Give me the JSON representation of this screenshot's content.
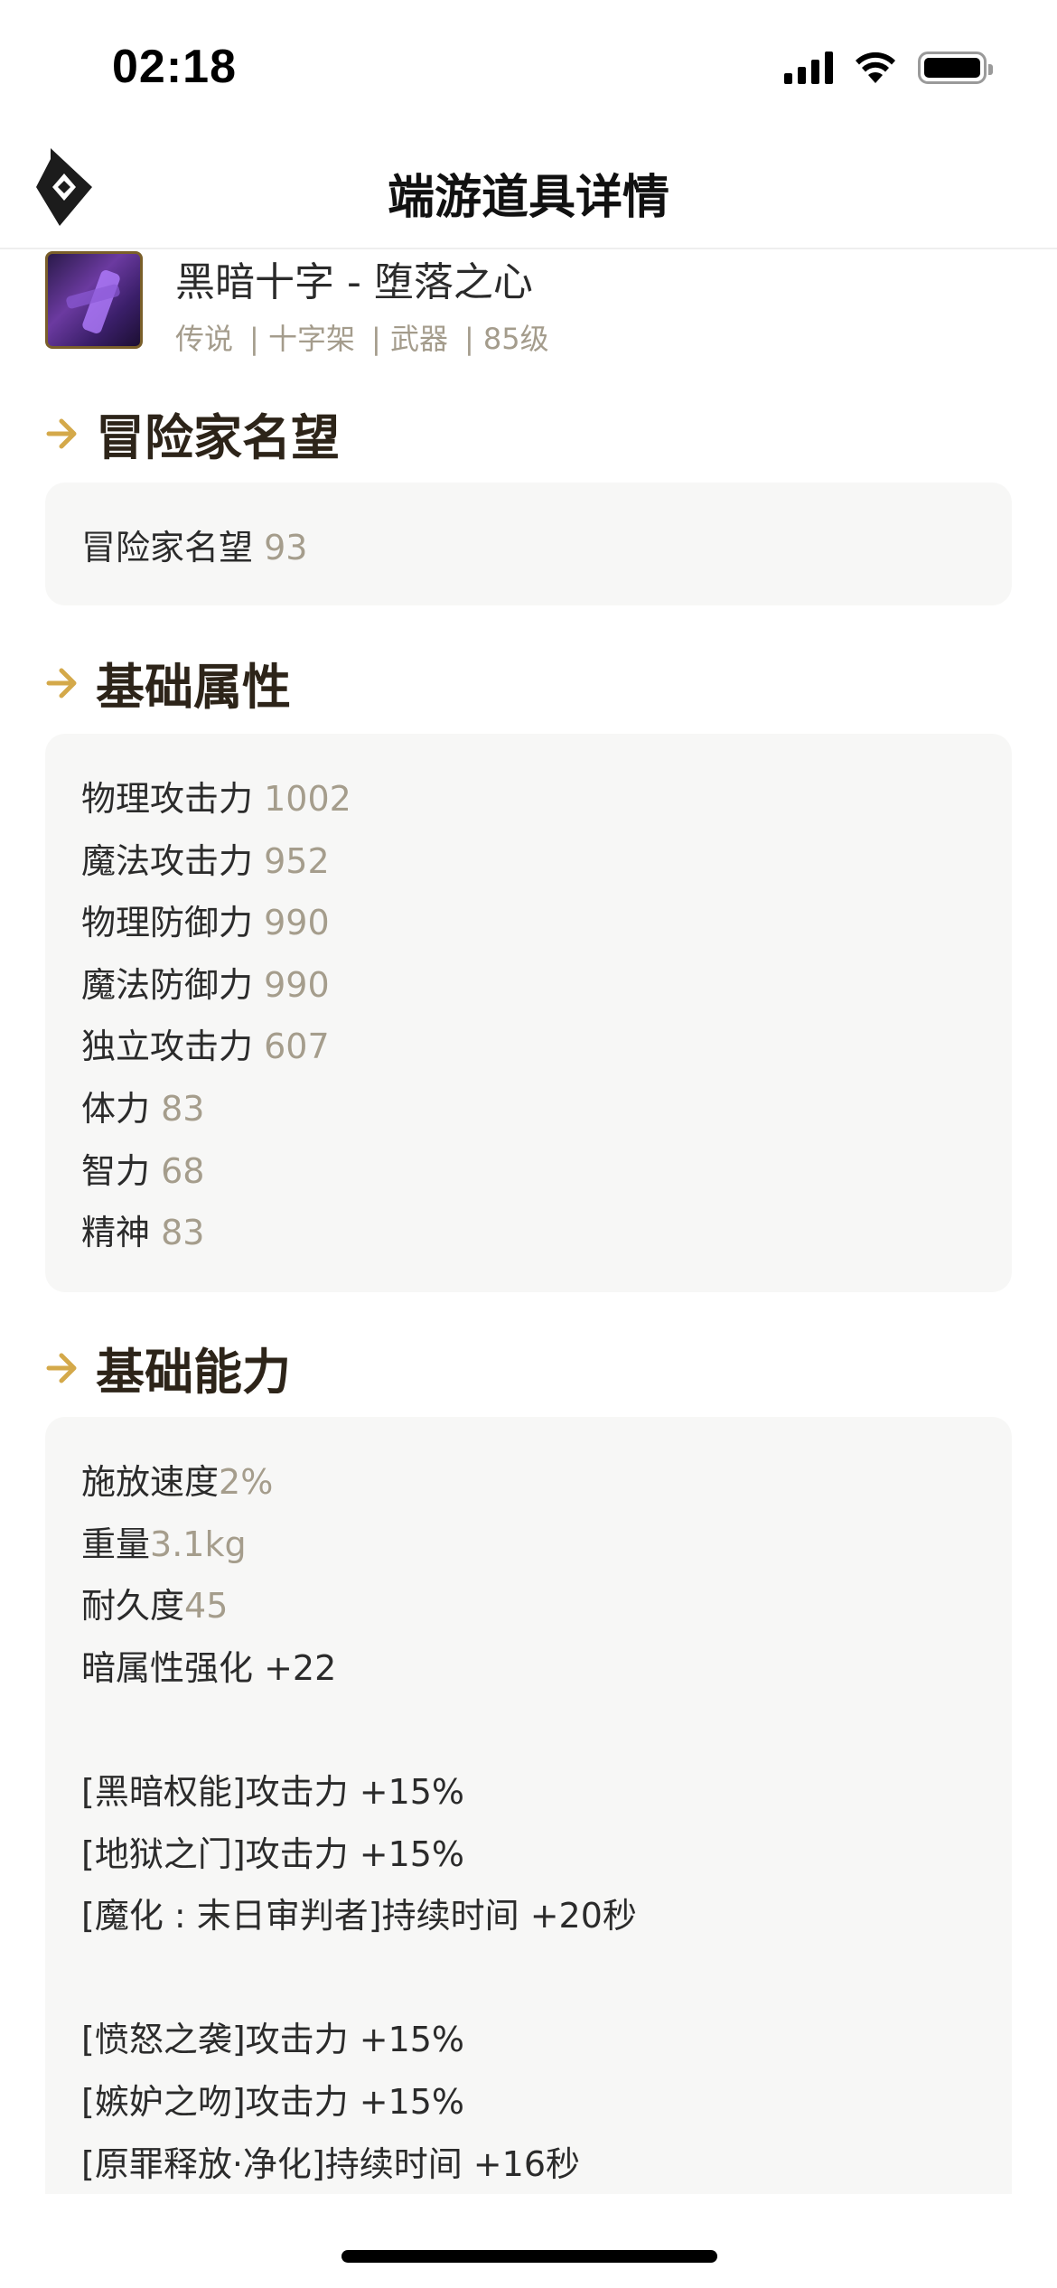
{
  "status_bar": {
    "time": "02:18"
  },
  "nav": {
    "title": "端游道具详情"
  },
  "item": {
    "name": "黑暗十字 - 堕落之心",
    "tags": [
      "传说",
      "| 十字架",
      "| 武器",
      "| 85级"
    ]
  },
  "sections": {
    "reputation": {
      "title": "冒险家名望",
      "rows": [
        {
          "label": "冒险家名望",
          "value": "93"
        }
      ]
    },
    "base_attributes": {
      "title": "基础属性",
      "rows": [
        {
          "label": "物理攻击力",
          "value": "1002"
        },
        {
          "label": "魔法攻击力",
          "value": "952"
        },
        {
          "label": "物理防御力",
          "value": "990"
        },
        {
          "label": "魔法防御力",
          "value": "990"
        },
        {
          "label": "独立攻击力",
          "value": "607"
        },
        {
          "label": "体力",
          "value": "83"
        },
        {
          "label": "智力",
          "value": "68"
        },
        {
          "label": "精神",
          "value": "83"
        }
      ]
    },
    "base_abilities": {
      "title": "基础能力",
      "rows": [
        {
          "label": "施放速度",
          "value": "2%"
        },
        {
          "label": "重量",
          "value": "3.1kg"
        },
        {
          "label": "耐久度",
          "value": "45"
        },
        {
          "label": "暗属性强化 +22"
        },
        {
          "label": "[黑暗权能]攻击力 +15%"
        },
        {
          "label": "[地狱之门]攻击力 +15%"
        },
        {
          "label": "[魔化 : 末日审判者]持续时间 +20秒"
        },
        {
          "label": "[愤怒之袭]攻击力 +15%"
        },
        {
          "label": "[嫉妒之吻]攻击力 +15%"
        },
        {
          "label": "[原罪释放·净化]持续时间 +16秒"
        }
      ]
    }
  }
}
